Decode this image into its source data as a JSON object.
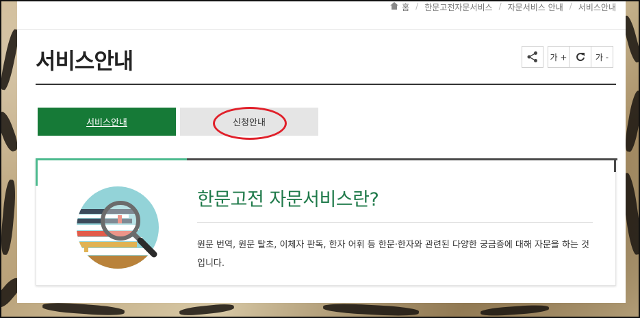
{
  "breadcrumb": {
    "home": "홈",
    "items": [
      "한문고전자문서비스",
      "자문서비스 안내",
      "서비스안내"
    ]
  },
  "page": {
    "title": "서비스안내"
  },
  "tools": {
    "share_icon": "share-icon",
    "font_increase": "가 +",
    "refresh_icon": "refresh-icon",
    "font_decrease": "가 -"
  },
  "tabs": [
    {
      "label": "서비스안내",
      "active": true
    },
    {
      "label": "신청안내",
      "active": false
    }
  ],
  "card": {
    "heading": "한문고전 자문서비스란?",
    "description": "원문 번역, 원문 탈초, 이체자 판독, 한자 어휘 등 한문·한자와 관련된 다양한 궁금증에 대해 자문을 하는 것입니다.",
    "illustration": "book-magnifier-icon"
  },
  "colors": {
    "accent_green": "#167a37",
    "heading_green": "#1f7a4a",
    "highlight_red": "#e0202a",
    "card_top_green": "#4cba8e"
  }
}
